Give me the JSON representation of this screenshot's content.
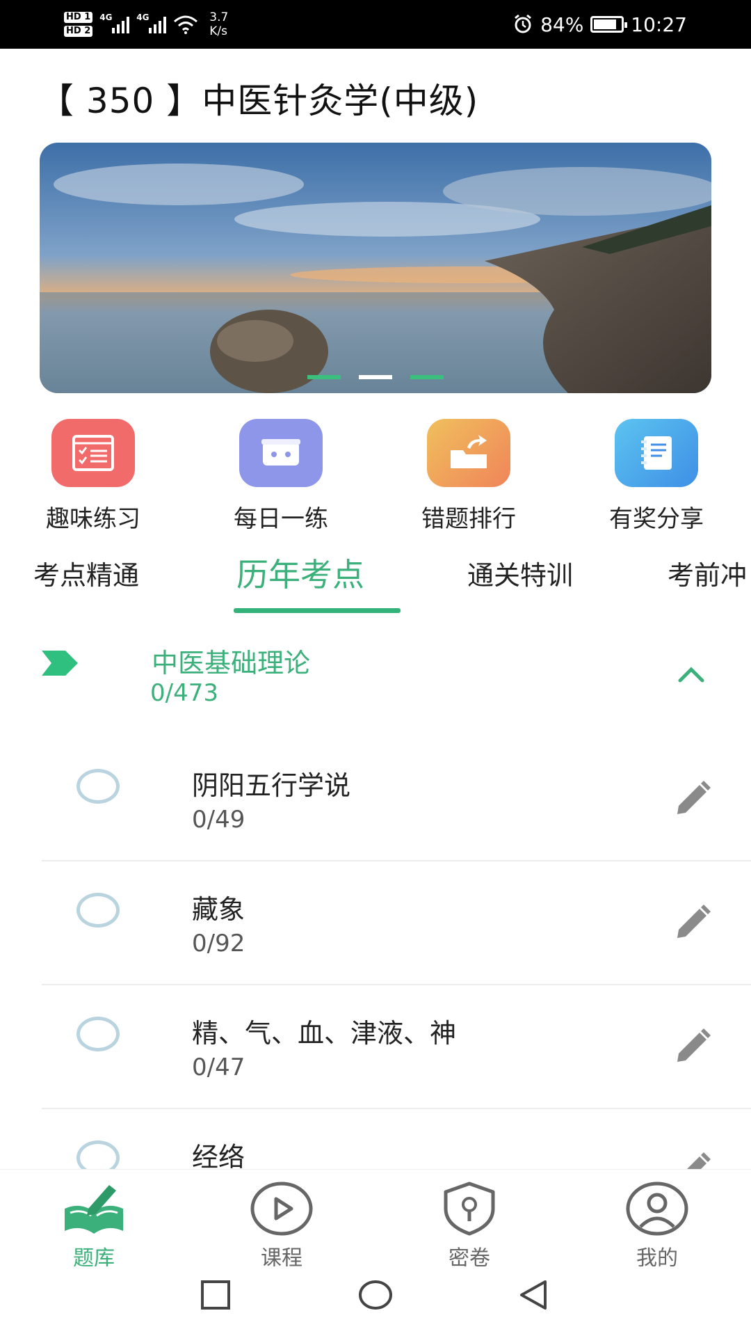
{
  "status_bar": {
    "hd1": "HD 1",
    "hd2": "HD 2",
    "net1": "4G",
    "net2": "4G",
    "speed_value": "3.7",
    "speed_unit": "K/s",
    "battery": "84%",
    "battery_level": 0.84,
    "time": "10:27"
  },
  "page": {
    "title": "【 350 】中医针灸学(中级)"
  },
  "banner": {
    "slide_count": 3,
    "active_index": 1
  },
  "quick_actions": [
    {
      "label": "趣味练习",
      "icon": "quiz-list-icon",
      "color": "#f26b6b"
    },
    {
      "label": "每日一练",
      "icon": "daily-box-icon",
      "color": "#8d96e8"
    },
    {
      "label": "错题排行",
      "icon": "share-folder-icon",
      "color": "#f29a5c"
    },
    {
      "label": "有奖分享",
      "icon": "notebook-icon",
      "color": "#4aa8ec"
    }
  ],
  "tabs": [
    {
      "label": "考点精通"
    },
    {
      "label": "历年考点",
      "active": true
    },
    {
      "label": "通关特训"
    },
    {
      "label": "考前冲"
    }
  ],
  "section": {
    "title": "中医基础理论",
    "count": "0/473"
  },
  "items": [
    {
      "name": "阴阳五行学说",
      "count": "0/49"
    },
    {
      "name": "藏象",
      "count": "0/92"
    },
    {
      "name": "精、气、血、津液、神",
      "count": "0/47"
    },
    {
      "name": "经络",
      "count": ""
    }
  ],
  "bottom_nav": [
    {
      "label": "题库",
      "icon": "question-bank-icon",
      "active": true
    },
    {
      "label": "课程",
      "icon": "play-circle-icon"
    },
    {
      "label": "密卷",
      "icon": "shield-lock-icon"
    },
    {
      "label": "我的",
      "icon": "user-profile-icon"
    }
  ],
  "colors": {
    "accent": "#3bb07a",
    "status_bar_bg": "#000000"
  }
}
